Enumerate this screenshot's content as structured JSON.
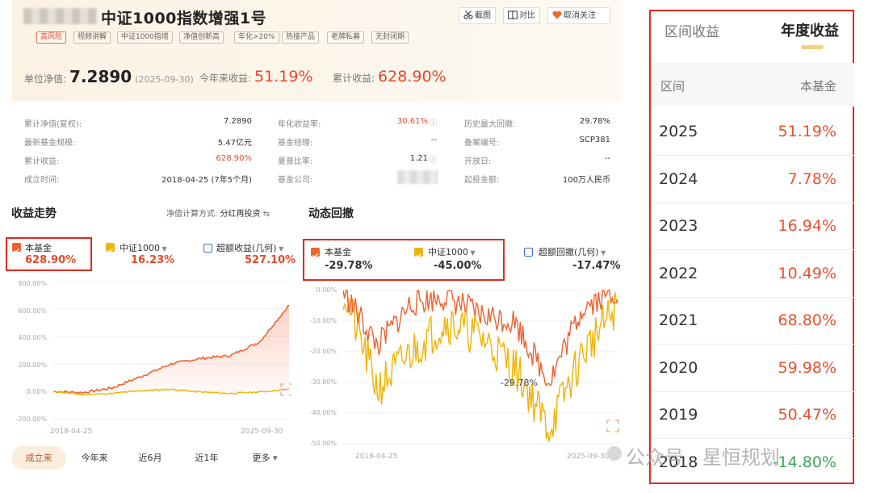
{
  "fund": {
    "name": "中证1000指数增强1号",
    "tags": [
      "高风险",
      "视频讲解",
      "中证1000指增",
      "净值创新高",
      "年化>20%",
      "热接产品",
      "老牌私募",
      "无封闭期"
    ]
  },
  "actions": {
    "screenshot": "截图",
    "compare": "对比",
    "unfollow": "取消关注"
  },
  "summary": {
    "nav_label": "单位净值:",
    "nav": "7.2890",
    "nav_date": "(2025-09-30)",
    "ytd_label": "今年来收益:",
    "ytd": "51.19%",
    "cum_label": "累计收益:",
    "cum": "628.90%"
  },
  "info": {
    "col1": [
      {
        "label": "累计净值(复权):",
        "value": "7.2890"
      },
      {
        "label": "最新基金规模:",
        "value": "5.47亿元"
      },
      {
        "label": "累计收益:",
        "value": "628.90%"
      },
      {
        "label": "成立时间:",
        "value": "2018-04-25 (7年5个月)"
      }
    ],
    "col2": [
      {
        "label": "年化收益率:",
        "value": "30.61%"
      },
      {
        "label": "基金经理:",
        "value": "--"
      },
      {
        "label": "夏普比率:",
        "value": "1.21"
      },
      {
        "label": "基金公司:",
        "value": ""
      }
    ],
    "col3": [
      {
        "label": "历史最大回撤:",
        "value": "29.78%"
      },
      {
        "label": "备案编号:",
        "value": "SCP381"
      },
      {
        "label": "开放日:",
        "value": "--"
      },
      {
        "label": "起投金额:",
        "value": "100万人民币"
      }
    ]
  },
  "returns": {
    "title": "收益走势",
    "calc_label": "净值计算方式:",
    "calc_value": "分红再投资",
    "legend": [
      {
        "name": "本基金",
        "value": "628.90%"
      },
      {
        "name": "中证1000",
        "value": "16.23%"
      },
      {
        "name": "超额收益(几何)",
        "value": "527.10%"
      }
    ],
    "yticks": [
      "800.00%",
      "600.00%",
      "400.00%",
      "200.00%",
      "0.00%",
      "-200.00%"
    ],
    "xticks": [
      "2018-04-25",
      "2025-09-30"
    ]
  },
  "drawdown": {
    "title": "动态回撤",
    "legend": [
      {
        "name": "本基金",
        "value": "-29.78%"
      },
      {
        "name": "中证1000",
        "value": "-45.00%"
      },
      {
        "name": "超额回撤(几何)",
        "value": "-17.47%"
      }
    ],
    "yticks": [
      "0.00%",
      "-10.00%",
      "-20.00%",
      "-30.00%",
      "-40.00%",
      "-50.00%"
    ],
    "xticks": [
      "2018-04-25",
      "2025-09-30"
    ],
    "annotation": "-29.78%"
  },
  "periods": [
    "成立来",
    "今年来",
    "近6月",
    "近1年",
    "更多"
  ],
  "yearly": {
    "tabs": [
      "区间收益",
      "年度收益"
    ],
    "header": [
      "区间",
      "本基金"
    ],
    "rows": [
      {
        "year": "2025",
        "value": "51.19%"
      },
      {
        "year": "2024",
        "value": "7.78%"
      },
      {
        "year": "2023",
        "value": "16.94%"
      },
      {
        "year": "2022",
        "value": "10.49%"
      },
      {
        "year": "2021",
        "value": "68.80%"
      },
      {
        "year": "2020",
        "value": "59.98%"
      },
      {
        "year": "2019",
        "value": "50.47%"
      },
      {
        "year": "2018",
        "value": "-14.80%"
      }
    ]
  },
  "watermark": "公众号 · 星恒规划",
  "colors": {
    "fund": "#f0612f",
    "index": "#f0b300",
    "excess": "#3a6fd8",
    "accent": "#e6482c",
    "frame": "#e02a1e"
  },
  "chart_data": [
    {
      "type": "line",
      "title": "收益走势",
      "x": [
        "2018-04-25",
        "2019-01",
        "2020-01",
        "2021-01",
        "2022-01",
        "2023-01",
        "2024-01",
        "2025-01",
        "2025-09-30"
      ],
      "ylim": [
        -200,
        800
      ],
      "series": [
        {
          "name": "本基金",
          "values": [
            0,
            -10,
            25,
            110,
            200,
            240,
            260,
            360,
            628.9
          ]
        },
        {
          "name": "中证1000",
          "values": [
            0,
            -25,
            -15,
            5,
            15,
            -5,
            -15,
            -5,
            16.23
          ]
        }
      ]
    },
    {
      "type": "line",
      "title": "动态回撤",
      "x": [
        "2018-04-25",
        "2019-01",
        "2020-01",
        "2021-01",
        "2022-01",
        "2023-01",
        "2024-01",
        "2025-01",
        "2025-09-30"
      ],
      "ylim": [
        -50,
        0
      ],
      "series": [
        {
          "name": "本基金",
          "values": [
            0,
            -18,
            -4,
            -2,
            -8,
            -10,
            -29.78,
            -5,
            0
          ]
        },
        {
          "name": "中证1000",
          "values": [
            0,
            -32,
            -20,
            -10,
            -15,
            -25,
            -45,
            -20,
            -5
          ]
        }
      ]
    }
  ]
}
